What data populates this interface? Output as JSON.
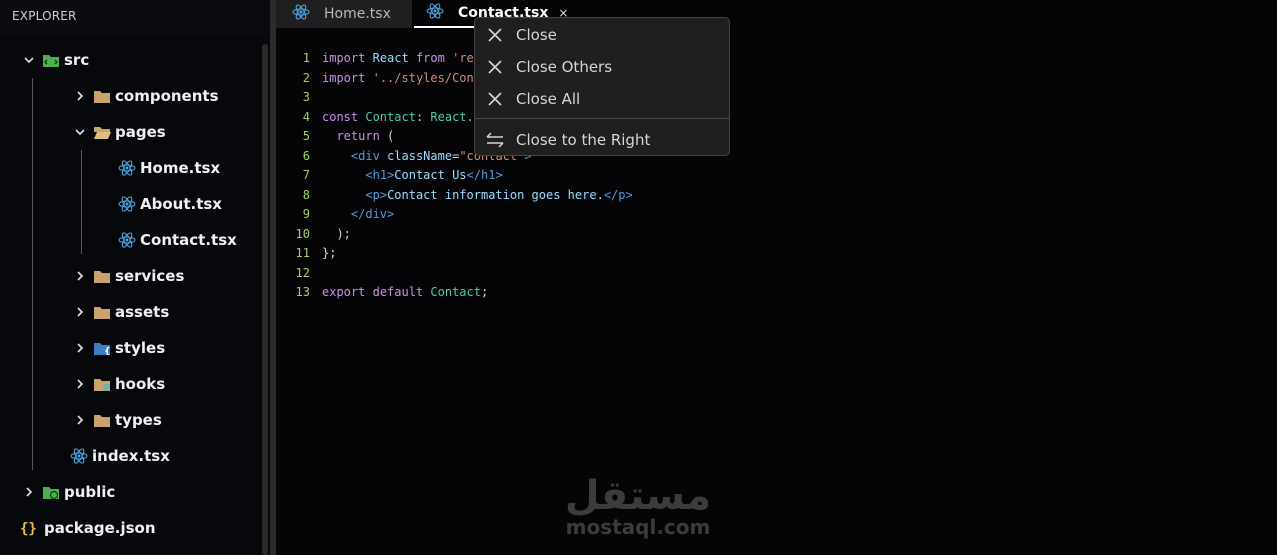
{
  "explorer": {
    "title": "EXPLORER",
    "tree": [
      {
        "label": "src",
        "icon": "folder-src-icon",
        "expanded": true
      },
      {
        "label": "components",
        "icon": "folder-icon",
        "expanded": false
      },
      {
        "label": "pages",
        "icon": "folder-open-icon",
        "expanded": true
      },
      {
        "label": "Home.tsx",
        "icon": "react-icon"
      },
      {
        "label": "About.tsx",
        "icon": "react-icon"
      },
      {
        "label": "Contact.tsx",
        "icon": "react-icon"
      },
      {
        "label": "services",
        "icon": "folder-icon",
        "expanded": false
      },
      {
        "label": "assets",
        "icon": "folder-icon",
        "expanded": false
      },
      {
        "label": "styles",
        "icon": "folder-styles-icon",
        "expanded": false
      },
      {
        "label": "hooks",
        "icon": "folder-hooks-icon",
        "expanded": false
      },
      {
        "label": "types",
        "icon": "folder-icon",
        "expanded": false
      },
      {
        "label": "index.tsx",
        "icon": "react-icon"
      },
      {
        "label": "public",
        "icon": "folder-public-icon",
        "expanded": false
      },
      {
        "label": "package.json",
        "icon": "json-braces-icon"
      }
    ]
  },
  "tabs": [
    {
      "label": "Home.tsx",
      "active": false
    },
    {
      "label": "Contact.tsx",
      "active": true,
      "close": "×"
    }
  ],
  "editor": {
    "line_numbers": [
      "1",
      "2",
      "3",
      "4",
      "5",
      "6",
      "7",
      "8",
      "9",
      "10",
      "11",
      "12",
      "13"
    ],
    "lines": [
      [
        "import",
        "React",
        "from",
        "'rea"
      ],
      [
        "import",
        "'../styles/Cont"
      ],
      [],
      [
        "const",
        "Contact",
        ":",
        "React."
      ],
      [
        "return",
        "("
      ],
      [
        "<",
        "div",
        "className",
        "=",
        "\"contact\"",
        ">"
      ],
      [
        "<",
        "h1",
        ">",
        "Contact Us",
        "</",
        "h1",
        ">"
      ],
      [
        "<",
        "p",
        ">",
        "Contact information goes here.",
        "</",
        "p",
        ">"
      ],
      [
        "</",
        "div",
        ">"
      ],
      [
        ");"
      ],
      [
        "};"
      ],
      [],
      [
        "export",
        "default",
        "Contact",
        ";"
      ]
    ]
  },
  "context_menu": {
    "items": [
      {
        "label": "Close",
        "icon": "close-icon"
      },
      {
        "label": "Close Others",
        "icon": "close-icon"
      },
      {
        "label": "Close All",
        "icon": "close-icon"
      },
      {
        "label": "Close to the Right",
        "icon": "swap-arrows-icon"
      }
    ]
  },
  "watermark": {
    "arabic": "مستقل",
    "latin": "mostaql.com"
  },
  "colors": {
    "background": "#050507",
    "keyword": "#c792ea",
    "identifier": "#9cdcfe",
    "type": "#4ec9b0",
    "string": "#ce9178",
    "tag": "#569cd6",
    "line_number": "#9fd26a",
    "menu_background": "#1f1f1f"
  }
}
